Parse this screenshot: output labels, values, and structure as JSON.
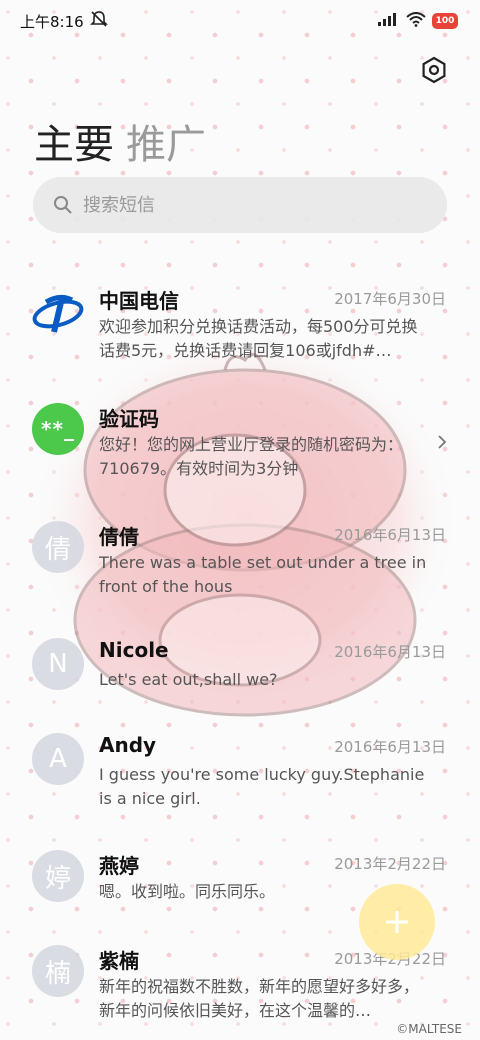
{
  "status_bar": {
    "time": "上午8:16",
    "battery": "100",
    "icons": [
      "mute-bell-icon",
      "signal-icon",
      "wifi-icon",
      "battery-icon"
    ]
  },
  "header": {
    "settings_icon": "settings-hexagon-icon",
    "tabs": [
      {
        "label": "主要",
        "active": true
      },
      {
        "label": "推广",
        "active": false
      }
    ]
  },
  "search": {
    "placeholder": "搜索短信",
    "value": ""
  },
  "conversations": [
    {
      "name": "中国电信",
      "date": "2017年6月30日",
      "preview": "欢迎参加积分兑换话费活动，每500分可兑换话费5元，兑换话费请回复106或jfdh#…",
      "avatar_type": "logo",
      "avatar_icon": "china-telecom-logo"
    },
    {
      "name": "验证码",
      "date": "",
      "preview": "您好！您的网上营业厅登录的随机密码为：710679。有效时间为3分钟",
      "avatar_type": "green",
      "avatar_text": "**_",
      "has_chevron": true
    },
    {
      "name": "倩倩",
      "date": "2016年6月13日",
      "preview": "There was a table set out under a tree in front of the hous",
      "avatar_type": "letter",
      "avatar_text": "倩"
    },
    {
      "name": "Nicole",
      "date": "2016年6月13日",
      "preview": "Let's eat out,shall we?",
      "avatar_type": "letter",
      "avatar_text": "N"
    },
    {
      "name": "Andy",
      "date": "2016年6月13日",
      "preview": "I guess you're some lucky guy.Stephanie is a nice girl.",
      "avatar_type": "letter",
      "avatar_text": "A"
    },
    {
      "name": "燕婷",
      "date": "2013年2月22日",
      "preview": "嗯。收到啦。同乐同乐。",
      "avatar_type": "letter",
      "avatar_text": "婷"
    },
    {
      "name": "紫楠",
      "date": "2013年2月22日",
      "preview": "新年的祝福数不胜数，新年的愿望好多好多，新年的问候依旧美好，在这个温馨的…",
      "avatar_type": "letter",
      "avatar_text": "楠"
    }
  ],
  "fab": {
    "icon": "plus-icon"
  },
  "watermark": "©MALTESE",
  "colors": {
    "accent_green": "#4cc94a",
    "telecom_blue": "#0a5cc4",
    "battery_red": "#e84338",
    "fab_yellow": "#ffe996"
  }
}
